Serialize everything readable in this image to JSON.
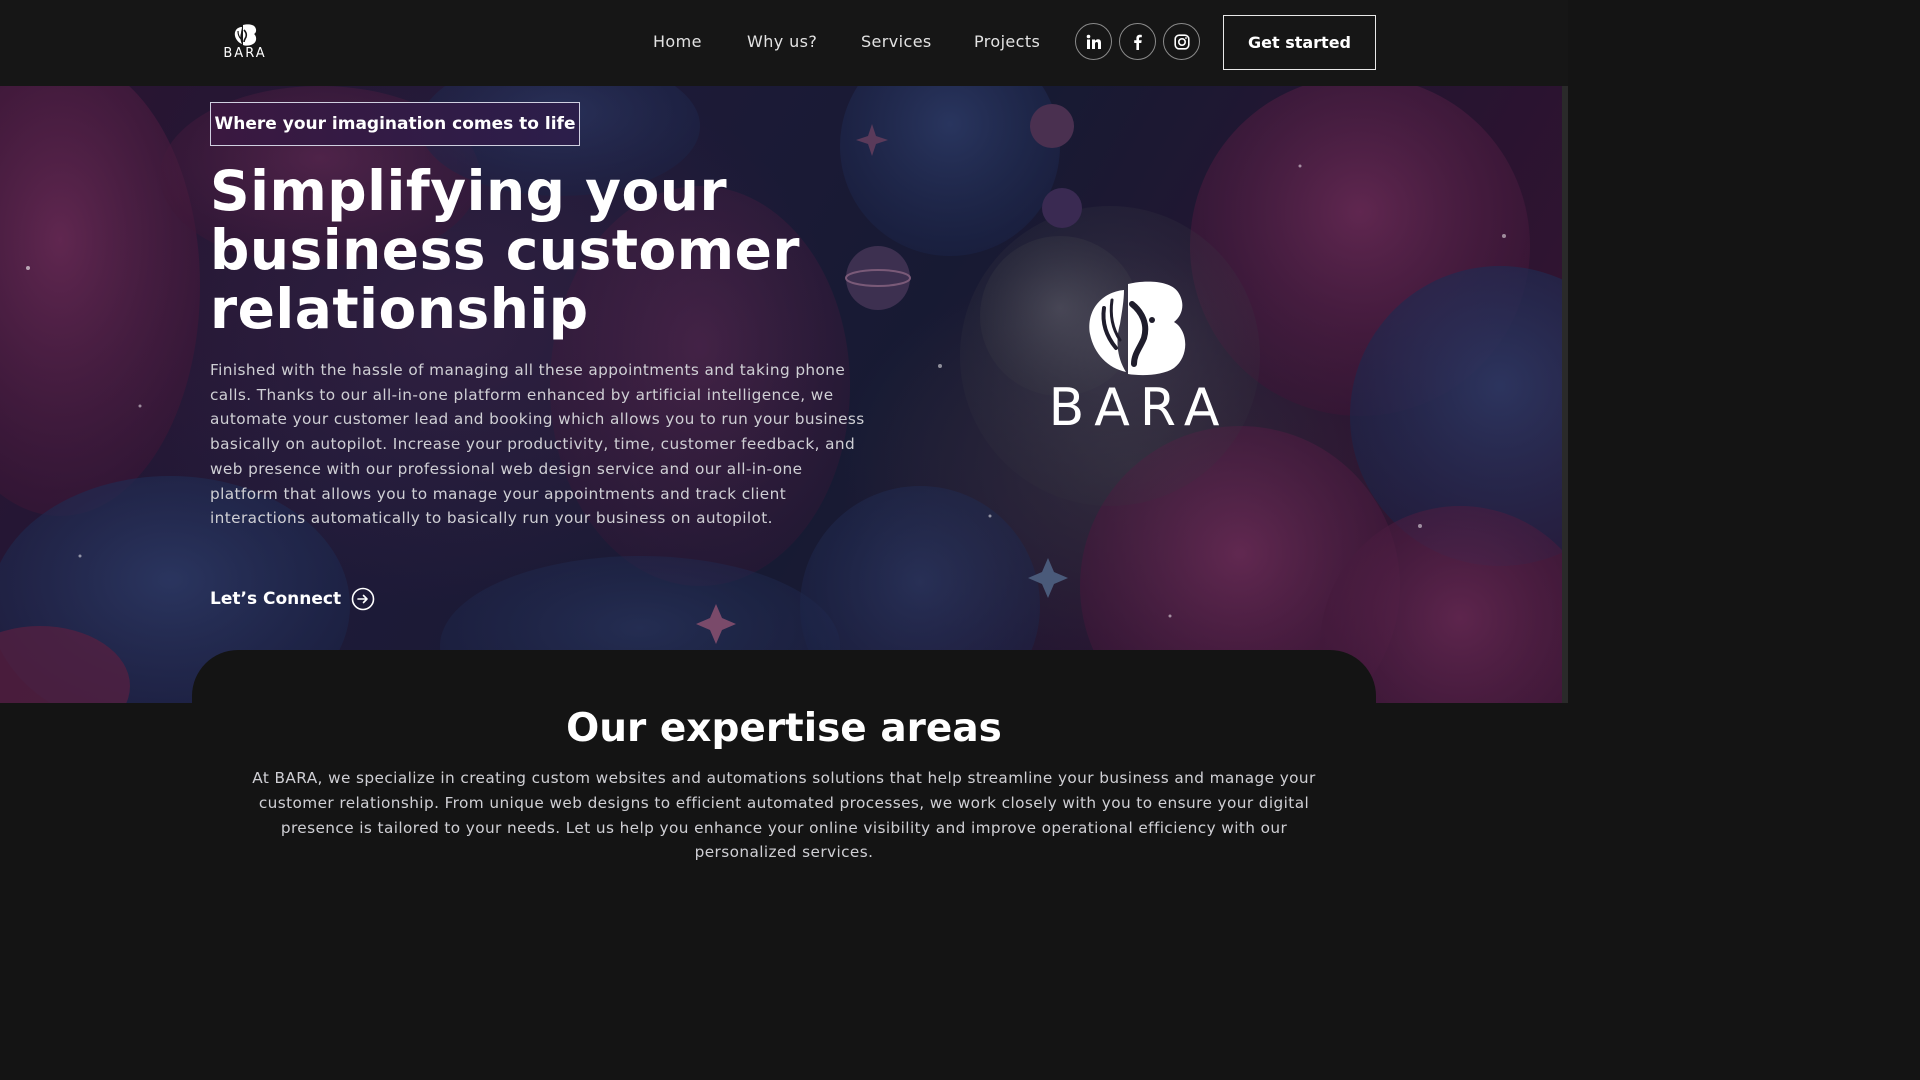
{
  "header": {
    "logo_text": "BARA",
    "nav": [
      {
        "label": "Home"
      },
      {
        "label": "Why us?"
      },
      {
        "label": "Services"
      },
      {
        "label": "Projects"
      }
    ],
    "social_icons": [
      "linkedin-icon",
      "facebook-icon",
      "instagram-icon"
    ],
    "cta_label": "Get started"
  },
  "hero": {
    "tagline": "Where your imagination comes to life",
    "title": "Simplifying your business customer relationship",
    "description": "Finished with the hassle of managing all these appointments and taking phone calls. Thanks to our all-in-one platform enhanced by artificial intelligence, we automate your customer lead and booking which allows you to run your business basically on autopilot. Increase your productivity, time, customer feedback, and web presence with our professional web design service and our all-in-one platform that allows you to manage your appointments and track client interactions automatically to basically run your business on autopilot.",
    "connect_label": "Let’s Connect",
    "logo_text": "BARA"
  },
  "expertise": {
    "title": "Our expertise areas",
    "description": "At BARA, we specialize in creating custom websites and automations solutions that help streamline your business and manage your customer relationship. From unique web designs to efficient automated processes, we work closely with you to ensure your digital presence is tailored to your needs. Let us help you enhance your online visibility and improve operational efficiency with our personalized services."
  },
  "colors": {
    "background": "#141414",
    "header": "#161616",
    "hero_purple": "#2b1330",
    "hero_navy": "#171a33",
    "text_muted": "#cfcfd4"
  }
}
